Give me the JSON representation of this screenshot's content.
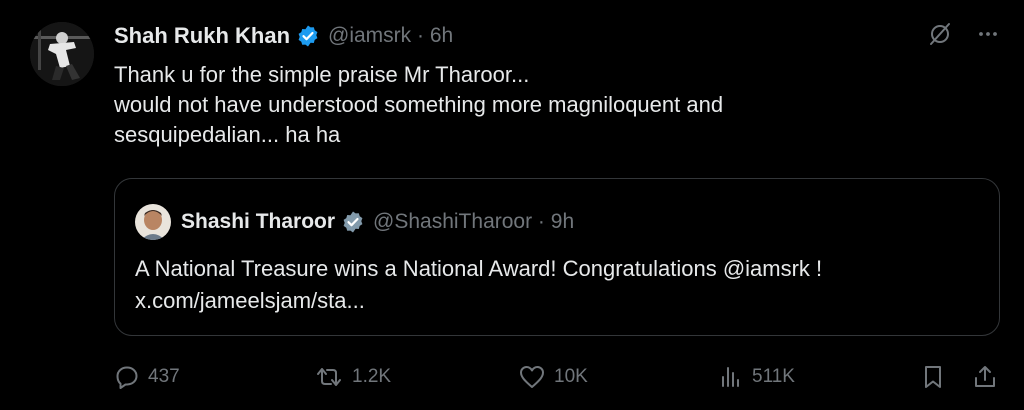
{
  "tweet": {
    "author_name": "Shah Rukh Khan",
    "author_handle": "@iamsrk",
    "time": "6h",
    "lines": [
      "Thank u for the simple praise Mr Tharoor...",
      "would not have understood something more magniloquent and",
      "sesquipedalian... ha ha"
    ]
  },
  "quote": {
    "author_name": "Shashi Tharoor",
    "author_handle": "@ShashiTharoor",
    "time": "9h",
    "lines": [
      "A National Treasure wins a National Award! Congratulations @iamsrk !",
      "x.com/jameelsjam/sta..."
    ]
  },
  "separator": " · ",
  "actions": {
    "replies": "437",
    "reposts": "1.2K",
    "likes": "10K",
    "views": "511K"
  },
  "colors": {
    "background": "#000000",
    "text": "#e7e9ea",
    "muted": "#71767b",
    "verified": "#1d9bf0",
    "quote_verified": "#829aab",
    "border": "#333639"
  },
  "icons": [
    "grok-icon",
    "more-icon",
    "reply-icon",
    "repost-icon",
    "like-icon",
    "views-icon",
    "bookmark-icon",
    "share-icon",
    "verified-icon"
  ]
}
